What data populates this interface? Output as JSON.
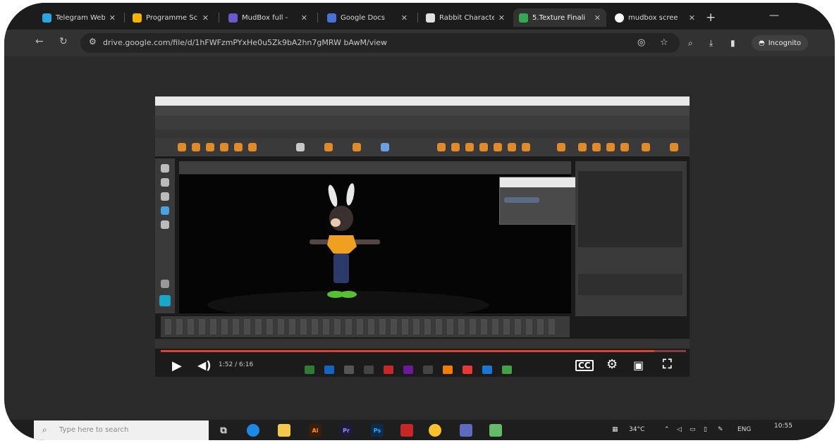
{
  "tabs": [
    {
      "label": "Telegram Web",
      "close": "✕",
      "color": "#2aa7e0"
    },
    {
      "label": "Programme Sc",
      "close": "✕",
      "color": "#f4b400"
    },
    {
      "label": "MudBox full -",
      "close": "✕",
      "color": "#6a5acd"
    },
    {
      "label": "Google Docs",
      "close": "✕",
      "color": "#4a72d6"
    },
    {
      "label": "Rabbit Characte",
      "close": "✕",
      "color": "#e0e0e0"
    },
    {
      "label": "5.Texture Finali",
      "close": "✕",
      "color": "#34a853"
    },
    {
      "label": "mudbox scree",
      "close": "✕",
      "color": "#ffffff"
    }
  ],
  "new_tab": "+",
  "minimize": "—",
  "address": {
    "url": "drive.google.com/file/d/1hFWFzmPYxHe0u5Zk9bA2hn7gMRW bAwM/view",
    "incognito_label": "Incognito"
  },
  "video": {
    "time": "1:52 / 6:16"
  },
  "taskbar": {
    "search_placeholder": "Type here to search",
    "temperature": "34°C",
    "language": "ENG",
    "clock": "10:55"
  },
  "colors": {
    "accent_red": "#e04030",
    "chrome_dark": "#1c1c1c"
  }
}
